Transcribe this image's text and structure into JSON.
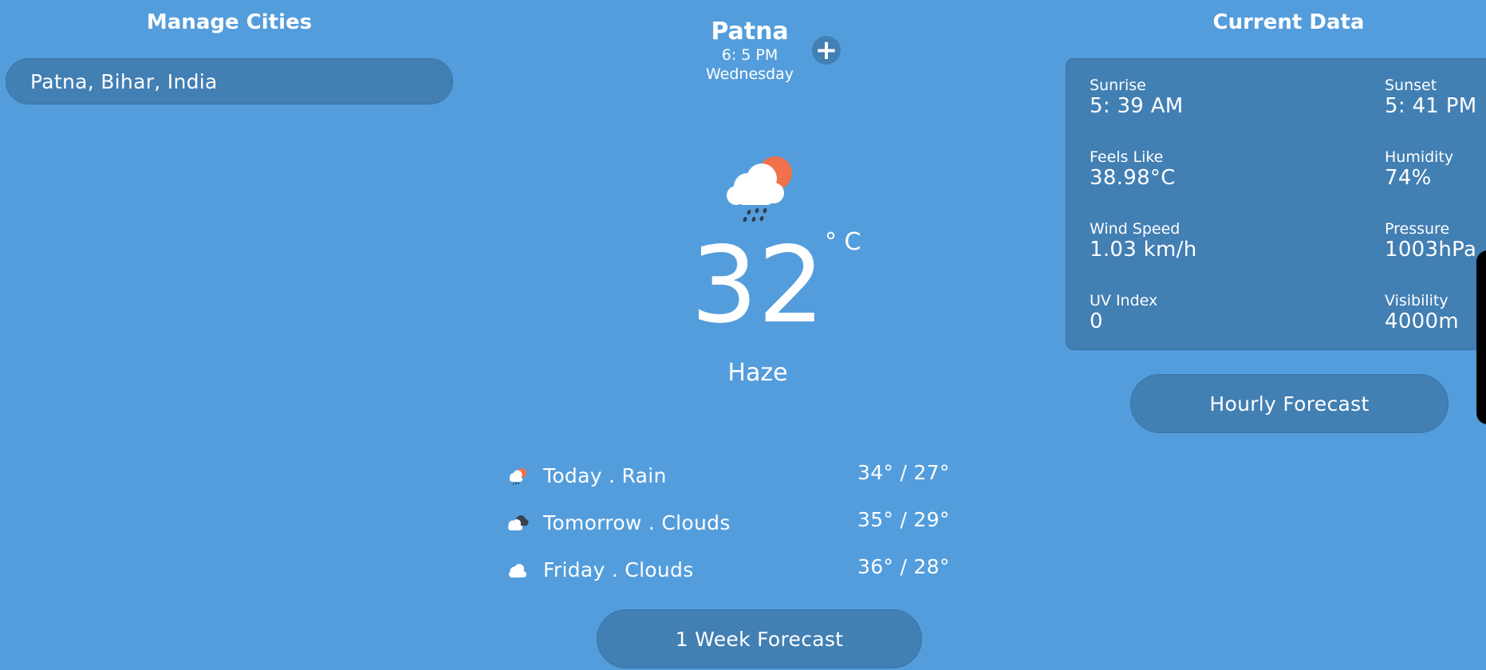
{
  "manage_cities": {
    "title": "Manage Cities",
    "cities": [
      "Patna, Bihar, India"
    ]
  },
  "location": {
    "name": "Patna",
    "time": "6: 5 PM",
    "day": "Wednesday",
    "add_label": "+"
  },
  "current": {
    "icon": "cloud-rain-sun-icon",
    "temperature": "32",
    "unit": "° C",
    "condition": "Haze"
  },
  "forecast": [
    {
      "icon": "cloud-rain-sun-icon",
      "label": "Today . Rain",
      "temp": "34° / 27°"
    },
    {
      "icon": "cloud-dark-icon",
      "label": "Tomorrow . Clouds",
      "temp": "35° / 29°"
    },
    {
      "icon": "cloud-icon",
      "label": "Friday . Clouds",
      "temp": "36° / 28°"
    }
  ],
  "week_button": "1 Week Forecast",
  "current_data": {
    "title": "Current Data",
    "items": [
      {
        "label": "Sunrise",
        "value": "5: 39 AM"
      },
      {
        "label": "Sunset",
        "value": "5: 41 PM"
      },
      {
        "label": "Feels Like",
        "value": "38.98°C"
      },
      {
        "label": "Humidity",
        "value": "74%"
      },
      {
        "label": "Wind Speed",
        "value": "1.03 km/h"
      },
      {
        "label": "Pressure",
        "value": "1003hPa"
      },
      {
        "label": "UV Index",
        "value": "0"
      },
      {
        "label": "Visibility",
        "value": "4000m"
      }
    ]
  },
  "hourly_button": "Hourly Forecast",
  "colors": {
    "background": "#549ddc",
    "panel": "#427fb3",
    "sun": "#f0714a",
    "text": "#ffffff"
  }
}
